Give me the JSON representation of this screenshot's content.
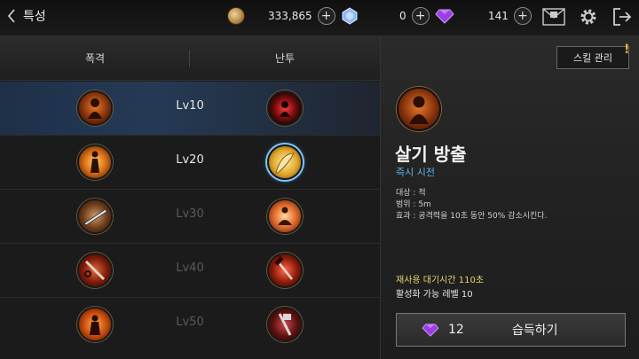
{
  "header": {
    "title": "특성",
    "gold": "333,865",
    "crystal": "0",
    "gem": "141"
  },
  "tabs": [
    "폭격",
    "난투"
  ],
  "rows": [
    {
      "level": "Lv10",
      "unlocked": true,
      "selected": true
    },
    {
      "level": "Lv20",
      "unlocked": true,
      "selected": false
    },
    {
      "level": "Lv30",
      "unlocked": false,
      "selected": false
    },
    {
      "level": "Lv40",
      "unlocked": false,
      "selected": false
    },
    {
      "level": "Lv50",
      "unlocked": false,
      "selected": false
    }
  ],
  "detail": {
    "manage_button": "스킬 관리",
    "manage_alert": "!",
    "skill_name": "살기 방출",
    "skill_type": "즉시 시전",
    "target": "대상 : 적",
    "range": "범위 : 5m",
    "effect": "효과 : 공격력을 10초 동안 50% 감소시킨다.",
    "cooldown": "재사용 대기시간 110초",
    "required_level": "활성화 가능 레벨 10",
    "cost": "12",
    "learn_label": "습득하기"
  },
  "colors": {
    "accent_blue": "#5ab4e6",
    "cooldown_yellow": "#e8d46a",
    "gem_purple": "#9b3fe0",
    "selected_row": "#253a55"
  }
}
